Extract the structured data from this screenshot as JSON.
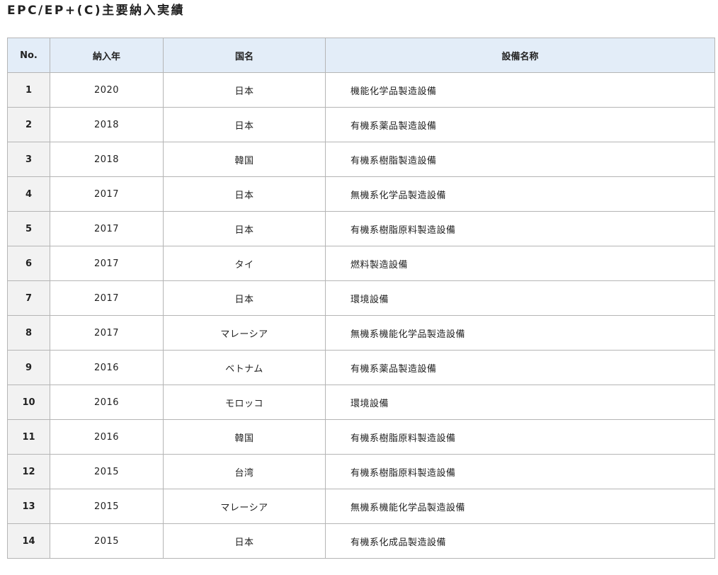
{
  "page": {
    "title": "EPC/EP+(C)主要納入実績"
  },
  "table": {
    "headers": {
      "no": "No.",
      "year": "納入年",
      "country": "国名",
      "facility": "設備名称"
    },
    "rows": [
      {
        "no": "1",
        "year": "2020",
        "country": "日本",
        "facility": "機能化学品製造設備"
      },
      {
        "no": "2",
        "year": "2018",
        "country": "日本",
        "facility": "有機系薬品製造設備"
      },
      {
        "no": "3",
        "year": "2018",
        "country": "韓国",
        "facility": "有機系樹脂製造設備"
      },
      {
        "no": "4",
        "year": "2017",
        "country": "日本",
        "facility": "無機系化学品製造設備"
      },
      {
        "no": "5",
        "year": "2017",
        "country": "日本",
        "facility": "有機系樹脂原料製造設備"
      },
      {
        "no": "6",
        "year": "2017",
        "country": "タイ",
        "facility": "燃料製造設備"
      },
      {
        "no": "7",
        "year": "2017",
        "country": "日本",
        "facility": "環境設備"
      },
      {
        "no": "8",
        "year": "2017",
        "country": "マレーシア",
        "facility": "無機系機能化学品製造設備"
      },
      {
        "no": "9",
        "year": "2016",
        "country": "ベトナム",
        "facility": "有機系薬品製造設備"
      },
      {
        "no": "10",
        "year": "2016",
        "country": "モロッコ",
        "facility": "環境設備"
      },
      {
        "no": "11",
        "year": "2016",
        "country": "韓国",
        "facility": "有機系樹脂原料製造設備"
      },
      {
        "no": "12",
        "year": "2015",
        "country": "台湾",
        "facility": "有機系樹脂原料製造設備"
      },
      {
        "no": "13",
        "year": "2015",
        "country": "マレーシア",
        "facility": "無機系機能化学品製造設備"
      },
      {
        "no": "14",
        "year": "2015",
        "country": "日本",
        "facility": "有機系化成品製造設備"
      }
    ]
  }
}
